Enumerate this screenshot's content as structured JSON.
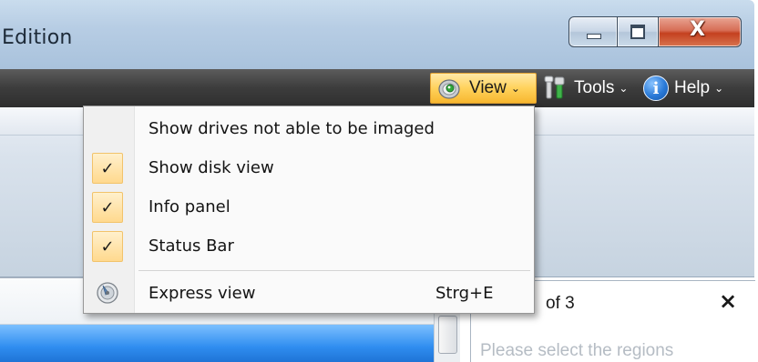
{
  "window": {
    "title": "Edition",
    "caption_buttons": {
      "minimize_icon": "minimize-icon",
      "maximize_icon": "maximize-icon",
      "close_icon": "close-icon",
      "close_glyph": "X"
    }
  },
  "toolbar": {
    "items": [
      {
        "label": "View",
        "icon": "view-eye-icon",
        "active": true
      },
      {
        "label": "Tools",
        "icon": "tools-icon",
        "active": false
      },
      {
        "label": "Help",
        "icon": "help-icon",
        "active": false
      }
    ],
    "chevron": "⌄",
    "help_glyph": "i"
  },
  "view_menu": {
    "items": [
      {
        "label": "Show drives not able to be imaged",
        "checked": false,
        "shortcut": ""
      },
      {
        "label": "Show disk view",
        "checked": true,
        "shortcut": ""
      },
      {
        "label": "Info panel",
        "checked": true,
        "shortcut": ""
      },
      {
        "label": "Status Bar",
        "checked": true,
        "shortcut": ""
      },
      {
        "label": "Express view",
        "checked": false,
        "shortcut": "Strg+E",
        "icon": "express-view-icon"
      }
    ],
    "check_glyph": "✓"
  },
  "side_panel": {
    "title": "of 3",
    "close_glyph": "×",
    "hint": "Please select the regions"
  },
  "colors": {
    "toolbar_dark": "#3c3c3c",
    "active_orange": "#ffd25c",
    "selection_blue": "#2f8df0",
    "close_red": "#c4401f"
  }
}
